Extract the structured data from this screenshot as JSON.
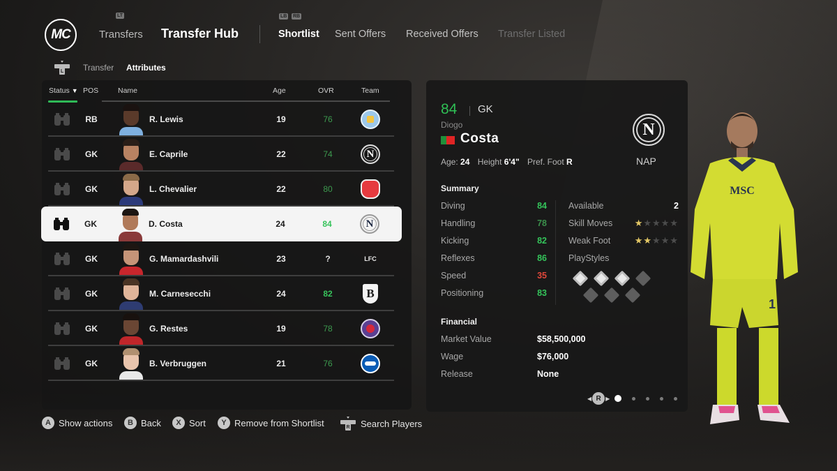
{
  "app": {
    "logo_text": "MC"
  },
  "nav": {
    "transfers_label": "Transfers",
    "hub_label": "Transfer Hub",
    "left_hint": "LT",
    "tab_hints": [
      "LB",
      "RB"
    ],
    "tabs": [
      {
        "label": "Shortlist",
        "state": "active"
      },
      {
        "label": "Sent Offers",
        "state": "normal"
      },
      {
        "label": "Received Offers",
        "state": "normal"
      },
      {
        "label": "Transfer Listed",
        "state": "disabled"
      }
    ]
  },
  "subnav": {
    "icon": "dpad-left-icon",
    "items": [
      "Transfer",
      "Attributes"
    ],
    "active": "Attributes"
  },
  "list": {
    "columns": {
      "status": "Status",
      "sort_indicator": "▼",
      "pos": "POS",
      "name": "Name",
      "age": "Age",
      "ovr": "OVR",
      "team": "Team"
    },
    "rows": [
      {
        "pos": "RB",
        "name": "R. Lewis",
        "age": "19",
        "ovr": "76",
        "ovr_tier": "mid",
        "team": "Manchester City",
        "crest": "mci",
        "selected": false
      },
      {
        "pos": "GK",
        "name": "E. Caprile",
        "age": "22",
        "ovr": "74",
        "ovr_tier": "mid",
        "team": "Napoli",
        "crest": "nap",
        "crest_text": "N",
        "selected": false
      },
      {
        "pos": "GK",
        "name": "L. Chevalier",
        "age": "22",
        "ovr": "80",
        "ovr_tier": "mid",
        "team": "Lille",
        "crest": "lil",
        "selected": false
      },
      {
        "pos": "GK",
        "name": "D. Costa",
        "age": "24",
        "ovr": "84",
        "ovr_tier": "high",
        "team": "Napoli",
        "crest": "nap",
        "crest_text": "N",
        "selected": true
      },
      {
        "pos": "GK",
        "name": "G. Mamardashvili",
        "age": "23",
        "ovr": "?",
        "ovr_tier": "unk",
        "team": "Liverpool",
        "crest": "liv",
        "crest_text": "LFC",
        "selected": false
      },
      {
        "pos": "GK",
        "name": "M. Carnesecchi",
        "age": "24",
        "ovr": "82",
        "ovr_tier": "high",
        "team": "Atalanta",
        "crest": "bol",
        "crest_text": "B",
        "selected": false
      },
      {
        "pos": "GK",
        "name": "G. Restes",
        "age": "19",
        "ovr": "78",
        "ovr_tier": "mid",
        "team": "Toulouse",
        "crest": "tfc",
        "selected": false
      },
      {
        "pos": "GK",
        "name": "B. Verbruggen",
        "age": "21",
        "ovr": "76",
        "ovr_tier": "mid",
        "team": "Brighton",
        "crest": "bha",
        "selected": false
      }
    ]
  },
  "detail": {
    "ovr": "84",
    "position": "GK",
    "first_name": "Diogo",
    "last_name": "Costa",
    "nationality": "Portugal",
    "age_label": "Age:",
    "age": "24",
    "height_label": "Height",
    "height": "6'4\"",
    "foot_label": "Pref. Foot",
    "foot": "R",
    "club_crest_text": "N",
    "club_abbr": "NAP",
    "summary_title": "Summary",
    "attributes": [
      {
        "label": "Diving",
        "value": "84",
        "tier": "high"
      },
      {
        "label": "Handling",
        "value": "78",
        "tier": "mid"
      },
      {
        "label": "Kicking",
        "value": "82",
        "tier": "high"
      },
      {
        "label": "Reflexes",
        "value": "86",
        "tier": "high"
      },
      {
        "label": "Speed",
        "value": "35",
        "tier": "low"
      },
      {
        "label": "Positioning",
        "value": "83",
        "tier": "high"
      }
    ],
    "available_label": "Available",
    "available": "2",
    "skill_moves_label": "Skill Moves",
    "skill_moves": 1,
    "skill_moves_max": 5,
    "weak_foot_label": "Weak Foot",
    "weak_foot": 2,
    "weak_foot_max": 5,
    "playstyles_label": "PlayStyles",
    "playstyles_filled": 3,
    "playstyles_slots": 7,
    "financial_title": "Financial",
    "financial": [
      {
        "label": "Market Value",
        "value": "$58,500,000"
      },
      {
        "label": "Wage",
        "value": "$76,000"
      },
      {
        "label": "Release",
        "value": "None"
      }
    ],
    "pager": {
      "button": "R",
      "pages": 5,
      "current": 1
    }
  },
  "footer": [
    {
      "button": "A",
      "label": "Show actions"
    },
    {
      "button": "B",
      "label": "Back"
    },
    {
      "button": "X",
      "label": "Sort"
    },
    {
      "button": "Y",
      "label": "Remove from Shortlist"
    },
    {
      "button": "R",
      "label": "Search Players",
      "icon": "dpad-icon"
    }
  ],
  "colors": {
    "accent_green": "#2fbf55",
    "low_red": "#e0473a",
    "star_gold": "#e3c765",
    "kit_yellow": "#d9e23a"
  }
}
